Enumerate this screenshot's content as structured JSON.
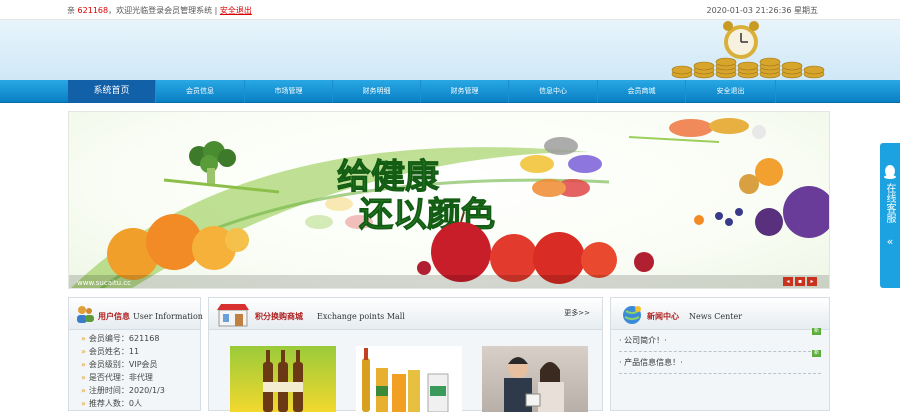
{
  "topbar": {
    "greet_prefix": "亲",
    "username": "621168",
    "greet_text": "，欢迎光临登录会员管理系统 |",
    "logout_link": "安全退出",
    "datetime": "2020-01-03 21:26:36 星期五"
  },
  "nav": {
    "items": [
      "系统首页",
      "会员信息",
      "市场管理",
      "财务明细",
      "财务管理",
      "信息中心",
      "会员商城",
      "安全退出"
    ]
  },
  "banner": {
    "slogan_line1": "给健康",
    "slogan_line2": "还以颜色",
    "url_text": "www.sucaitu.cc",
    "controls": [
      "◂",
      "▪",
      "▸"
    ]
  },
  "user_panel": {
    "title_cn": "用户信息",
    "title_en": "User Information",
    "rows": [
      "会员编号：621168",
      "会员姓名：11",
      "会员级别：VIP会员",
      "是否代理：非代理",
      "注册时间：2020/1/3",
      "推荐人数：0人"
    ]
  },
  "mall_panel": {
    "title_cn": "积分换购商城",
    "title_en": "Exchange points Mall",
    "more": "更多>>"
  },
  "news_panel": {
    "title_cn": "新闻中心",
    "title_en": "News Center",
    "items": [
      {
        "text": "· 公司简介！·",
        "badge": "新"
      },
      {
        "text": "· 产品信息信息！·",
        "badge": "新"
      }
    ]
  },
  "kefu": {
    "label": "在线客服",
    "arrow": "«"
  }
}
